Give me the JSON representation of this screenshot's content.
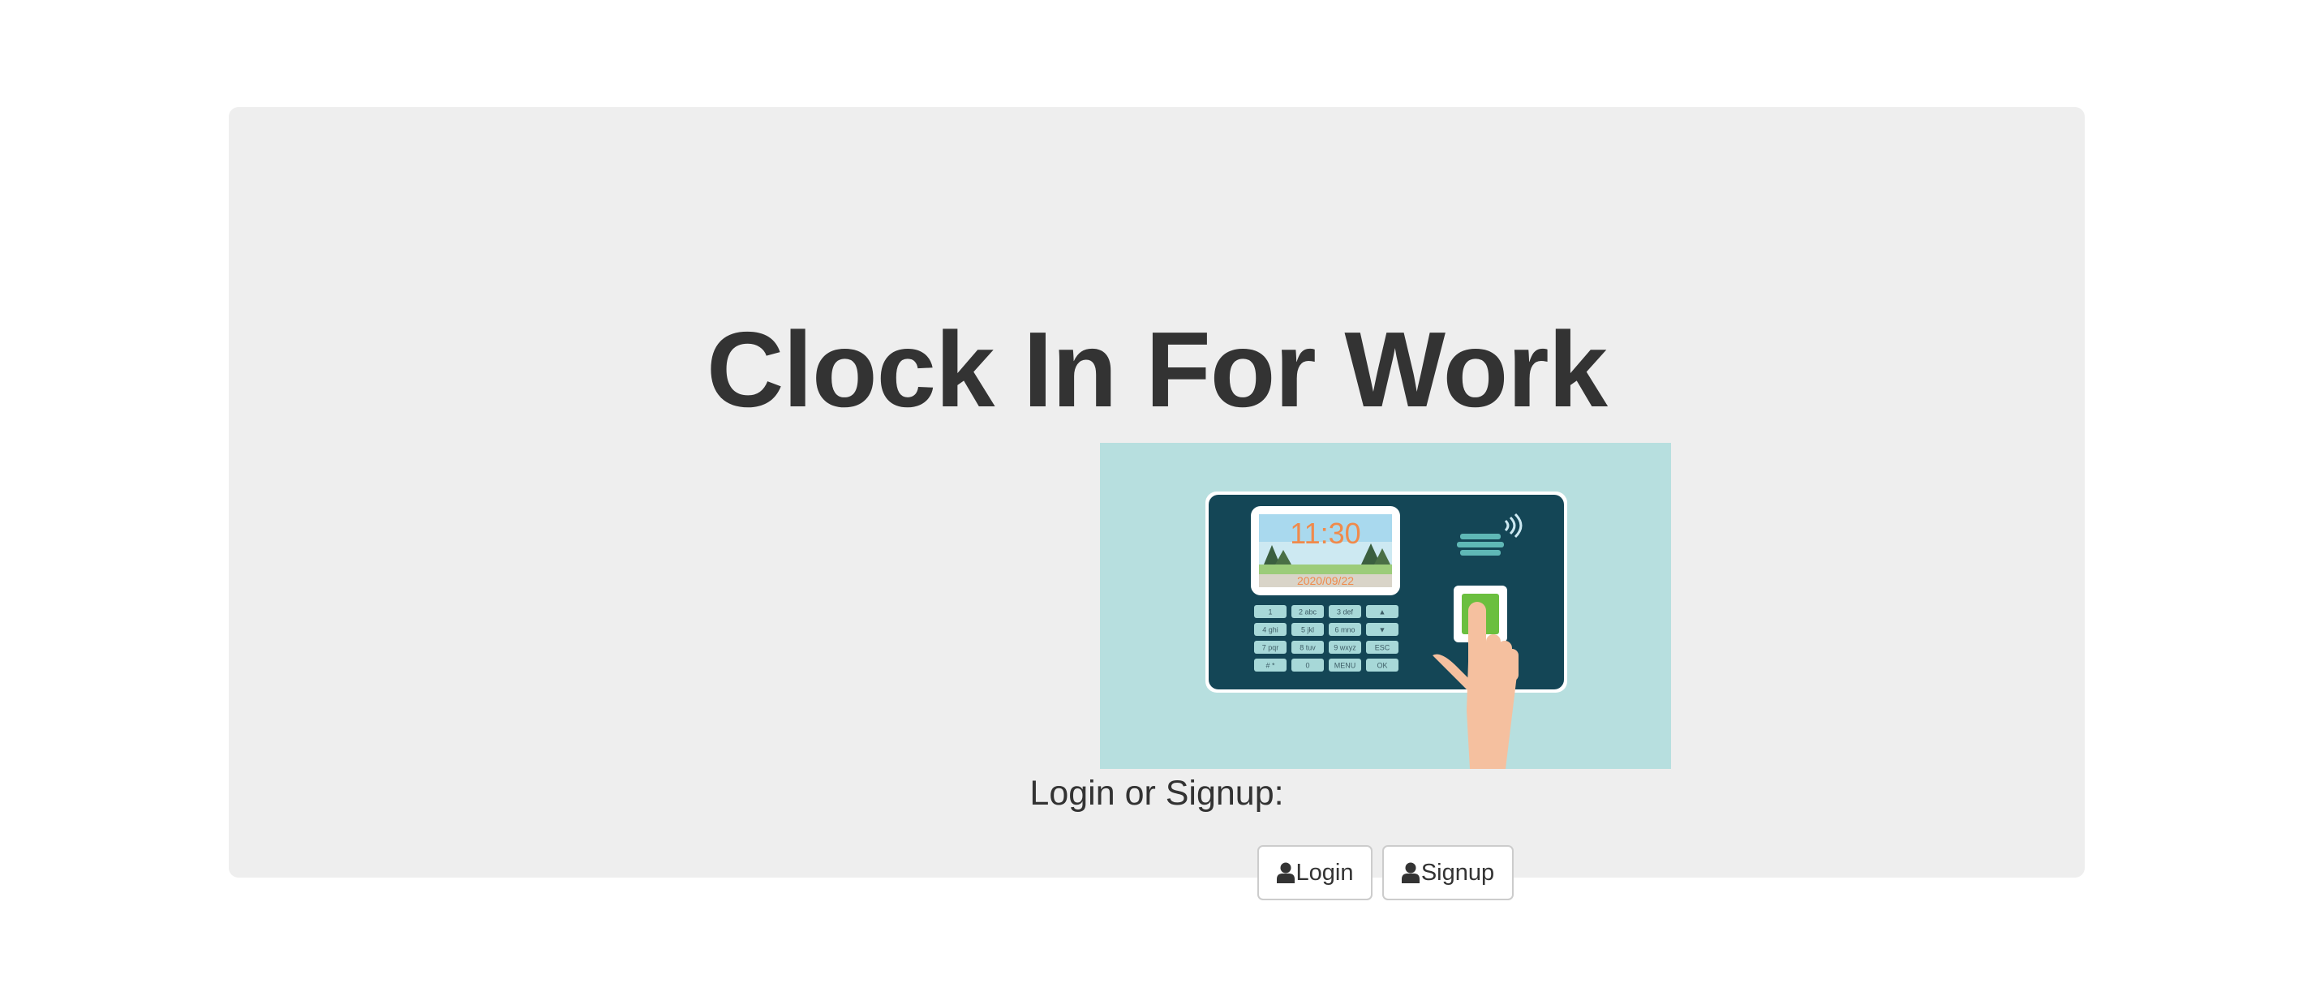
{
  "page": {
    "title": "Clock In For Work",
    "subtitle": "Login or Signup:"
  },
  "image": {
    "alt": "Clock In For Work",
    "device_time": "11:30",
    "device_date": "2020/09/22",
    "keypad": [
      [
        "1",
        "2 abc",
        "3 def",
        "▲"
      ],
      [
        "4 ghi",
        "5 jkl",
        "6 mno",
        "▼"
      ],
      [
        "7 pqr",
        "8 tuv",
        "9 wxyz",
        "ESC"
      ],
      [
        "# *",
        "0",
        "MENU",
        "OK"
      ]
    ]
  },
  "buttons": {
    "login_label": "Login",
    "signup_label": "Signup",
    "login_icon": "user-icon",
    "signup_icon": "user-icon"
  },
  "colors": {
    "jumbotron_bg": "#eeeeee",
    "text": "#333333",
    "image_bg": "#b7dfdf",
    "device_body": "#144656"
  }
}
